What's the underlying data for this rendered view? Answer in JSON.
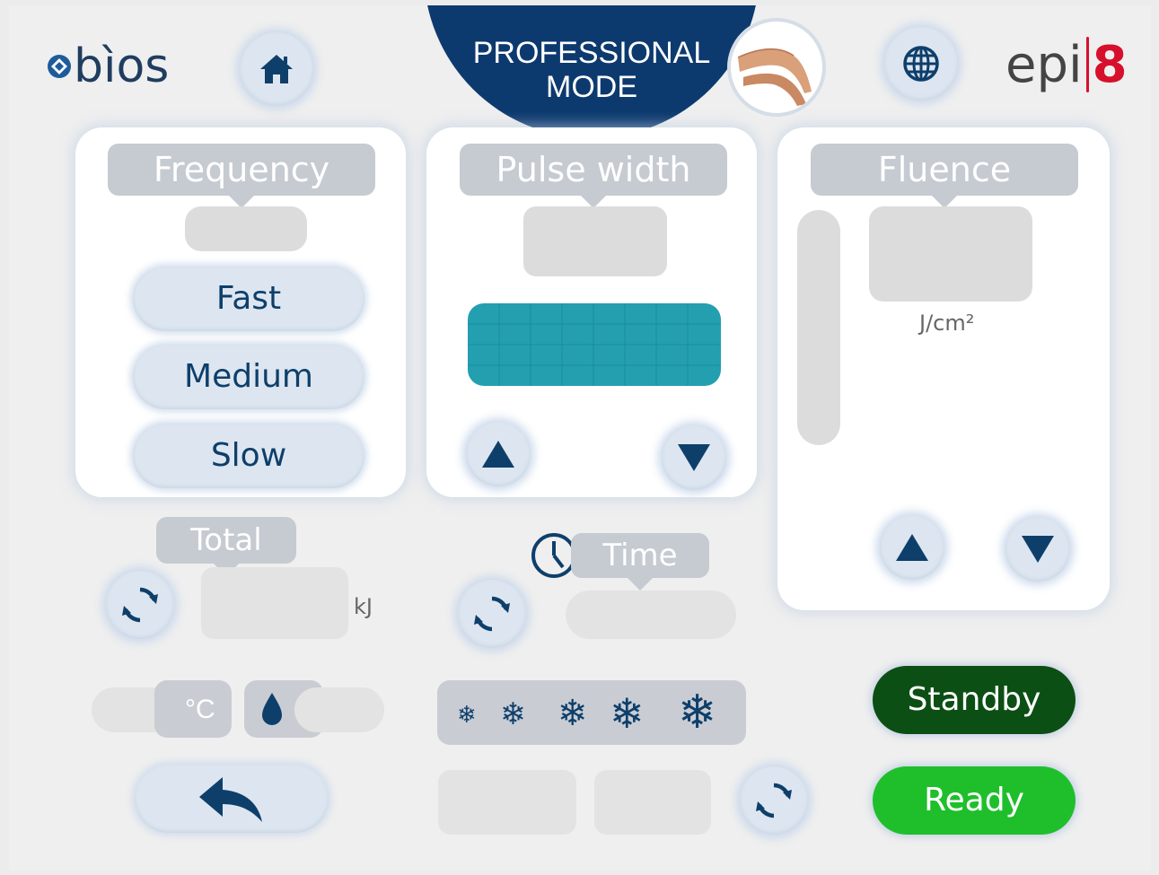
{
  "brand": {
    "left_logo": "bìos",
    "right_logo_text": "epi",
    "right_logo_mark": "8"
  },
  "header": {
    "mode_title_line1": "PROFESSIONAL",
    "mode_title_line2": "MODE"
  },
  "frequency": {
    "label": "Frequency",
    "options": [
      "Fast",
      "Medium",
      "Slow"
    ]
  },
  "pulse_width": {
    "label": "Pulse width"
  },
  "fluence": {
    "label": "Fluence",
    "unit": "J/cm²"
  },
  "total": {
    "label": "Total",
    "unit": "kJ"
  },
  "time": {
    "label": "Time"
  },
  "temperature": {
    "unit": "°C"
  },
  "status": {
    "standby_label": "Standby",
    "ready_label": "Ready"
  },
  "colors": {
    "brand_blue": "#0e3f6b",
    "header_blue": "#0d3a6e",
    "pulse_teal": "#239fb0",
    "standby_green": "#0c4f14",
    "ready_green": "#1fbf2c",
    "logo_red": "#d6102c"
  },
  "icons": [
    "home-icon",
    "globe-icon",
    "refresh-icon",
    "clock-icon",
    "droplet-icon",
    "snowflake-icon",
    "back-arrow-icon",
    "arrow-up-icon",
    "arrow-down-icon"
  ]
}
